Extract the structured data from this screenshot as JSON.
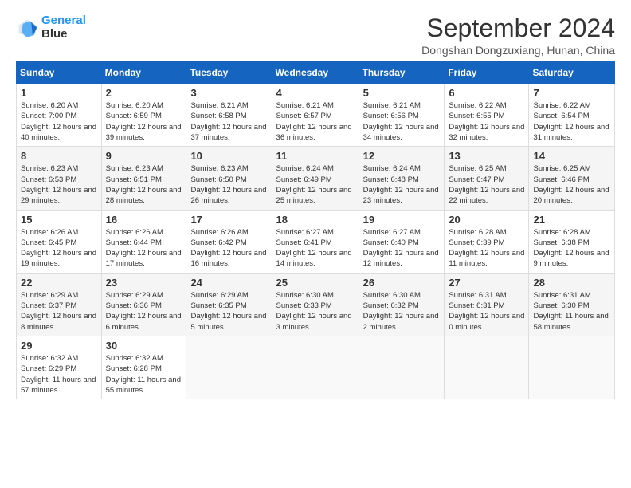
{
  "header": {
    "logo_line1": "General",
    "logo_line2": "Blue",
    "title": "September 2024",
    "subtitle": "Dongshan Dongzuxiang, Hunan, China"
  },
  "calendar": {
    "headers": [
      "Sunday",
      "Monday",
      "Tuesday",
      "Wednesday",
      "Thursday",
      "Friday",
      "Saturday"
    ],
    "weeks": [
      [
        {
          "day": "",
          "info": ""
        },
        {
          "day": "2",
          "info": "Sunrise: 6:20 AM\nSunset: 6:59 PM\nDaylight: 12 hours\nand 39 minutes."
        },
        {
          "day": "3",
          "info": "Sunrise: 6:21 AM\nSunset: 6:58 PM\nDaylight: 12 hours\nand 37 minutes."
        },
        {
          "day": "4",
          "info": "Sunrise: 6:21 AM\nSunset: 6:57 PM\nDaylight: 12 hours\nand 36 minutes."
        },
        {
          "day": "5",
          "info": "Sunrise: 6:21 AM\nSunset: 6:56 PM\nDaylight: 12 hours\nand 34 minutes."
        },
        {
          "day": "6",
          "info": "Sunrise: 6:22 AM\nSunset: 6:55 PM\nDaylight: 12 hours\nand 32 minutes."
        },
        {
          "day": "7",
          "info": "Sunrise: 6:22 AM\nSunset: 6:54 PM\nDaylight: 12 hours\nand 31 minutes."
        }
      ],
      [
        {
          "day": "1",
          "info": "Sunrise: 6:20 AM\nSunset: 7:00 PM\nDaylight: 12 hours\nand 40 minutes.",
          "first_row_sunday": true
        },
        {
          "day": "8",
          "info": "Sunrise: 6:23 AM\nSunset: 6:53 PM\nDaylight: 12 hours\nand 29 minutes."
        },
        {
          "day": "9",
          "info": "Sunrise: 6:23 AM\nSunset: 6:51 PM\nDaylight: 12 hours\nand 28 minutes."
        },
        {
          "day": "10",
          "info": "Sunrise: 6:23 AM\nSunset: 6:50 PM\nDaylight: 12 hours\nand 26 minutes."
        },
        {
          "day": "11",
          "info": "Sunrise: 6:24 AM\nSunset: 6:49 PM\nDaylight: 12 hours\nand 25 minutes."
        },
        {
          "day": "12",
          "info": "Sunrise: 6:24 AM\nSunset: 6:48 PM\nDaylight: 12 hours\nand 23 minutes."
        },
        {
          "day": "13",
          "info": "Sunrise: 6:25 AM\nSunset: 6:47 PM\nDaylight: 12 hours\nand 22 minutes."
        },
        {
          "day": "14",
          "info": "Sunrise: 6:25 AM\nSunset: 6:46 PM\nDaylight: 12 hours\nand 20 minutes."
        }
      ],
      [
        {
          "day": "15",
          "info": "Sunrise: 6:26 AM\nSunset: 6:45 PM\nDaylight: 12 hours\nand 19 minutes."
        },
        {
          "day": "16",
          "info": "Sunrise: 6:26 AM\nSunset: 6:44 PM\nDaylight: 12 hours\nand 17 minutes."
        },
        {
          "day": "17",
          "info": "Sunrise: 6:26 AM\nSunset: 6:42 PM\nDaylight: 12 hours\nand 16 minutes."
        },
        {
          "day": "18",
          "info": "Sunrise: 6:27 AM\nSunset: 6:41 PM\nDaylight: 12 hours\nand 14 minutes."
        },
        {
          "day": "19",
          "info": "Sunrise: 6:27 AM\nSunset: 6:40 PM\nDaylight: 12 hours\nand 12 minutes."
        },
        {
          "day": "20",
          "info": "Sunrise: 6:28 AM\nSunset: 6:39 PM\nDaylight: 12 hours\nand 11 minutes."
        },
        {
          "day": "21",
          "info": "Sunrise: 6:28 AM\nSunset: 6:38 PM\nDaylight: 12 hours\nand 9 minutes."
        }
      ],
      [
        {
          "day": "22",
          "info": "Sunrise: 6:29 AM\nSunset: 6:37 PM\nDaylight: 12 hours\nand 8 minutes."
        },
        {
          "day": "23",
          "info": "Sunrise: 6:29 AM\nSunset: 6:36 PM\nDaylight: 12 hours\nand 6 minutes."
        },
        {
          "day": "24",
          "info": "Sunrise: 6:29 AM\nSunset: 6:35 PM\nDaylight: 12 hours\nand 5 minutes."
        },
        {
          "day": "25",
          "info": "Sunrise: 6:30 AM\nSunset: 6:33 PM\nDaylight: 12 hours\nand 3 minutes."
        },
        {
          "day": "26",
          "info": "Sunrise: 6:30 AM\nSunset: 6:32 PM\nDaylight: 12 hours\nand 2 minutes."
        },
        {
          "day": "27",
          "info": "Sunrise: 6:31 AM\nSunset: 6:31 PM\nDaylight: 12 hours\nand 0 minutes."
        },
        {
          "day": "28",
          "info": "Sunrise: 6:31 AM\nSunset: 6:30 PM\nDaylight: 11 hours\nand 58 minutes."
        }
      ],
      [
        {
          "day": "29",
          "info": "Sunrise: 6:32 AM\nSunset: 6:29 PM\nDaylight: 11 hours\nand 57 minutes."
        },
        {
          "day": "30",
          "info": "Sunrise: 6:32 AM\nSunset: 6:28 PM\nDaylight: 11 hours\nand 55 minutes."
        },
        {
          "day": "",
          "info": ""
        },
        {
          "day": "",
          "info": ""
        },
        {
          "day": "",
          "info": ""
        },
        {
          "day": "",
          "info": ""
        },
        {
          "day": "",
          "info": ""
        }
      ]
    ]
  }
}
